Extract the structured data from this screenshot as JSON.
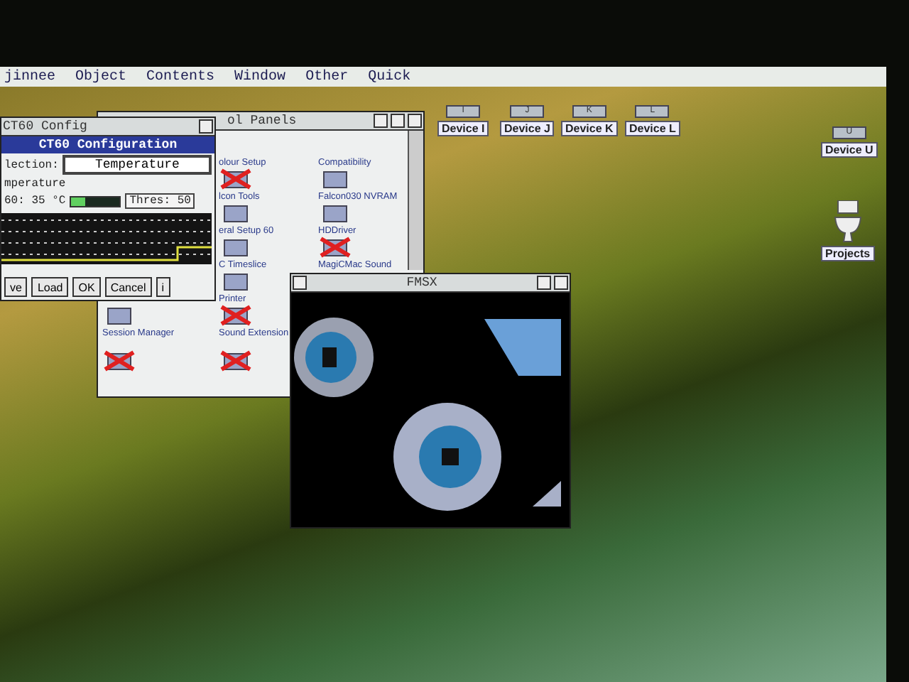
{
  "menu_bar": {
    "items": [
      "jinnee",
      "Object",
      "Contents",
      "Window",
      "Other",
      "Quick"
    ]
  },
  "desktop_icons": [
    {
      "kind": "drive",
      "letter": "I",
      "label": "Device I"
    },
    {
      "kind": "drive",
      "letter": "J",
      "label": "Device J"
    },
    {
      "kind": "drive",
      "letter": "K",
      "label": "Device K"
    },
    {
      "kind": "drive",
      "letter": "L",
      "label": "Device L"
    },
    {
      "kind": "drive",
      "letter": "U",
      "label": "Device U"
    },
    {
      "kind": "trash",
      "label": "Projects"
    }
  ],
  "control_panels": {
    "title": "ol Panels",
    "rows": [
      {
        "cells": [
          null,
          {
            "label": "olour Setup",
            "disabled": false,
            "kind": "blank"
          },
          {
            "label": "Compatibility",
            "disabled": false,
            "kind": "blank"
          }
        ]
      },
      {
        "cells": [
          null,
          {
            "label": "lcon Tools",
            "disabled": true,
            "kind": "module"
          },
          {
            "label": "Falcon030 NVRAM",
            "disabled": false,
            "kind": "module"
          }
        ]
      },
      {
        "cells": [
          null,
          {
            "label": "eral Setup 60",
            "disabled": false,
            "kind": "module"
          },
          {
            "label": "HDDriver",
            "disabled": false,
            "kind": "module"
          }
        ]
      },
      {
        "cells": [
          null,
          {
            "label": "C Timeslice",
            "disabled": false,
            "kind": "module"
          },
          {
            "label": "MagiCMac Sound",
            "disabled": true,
            "kind": "module"
          }
        ]
      },
      {
        "cells": [
          null,
          {
            "label": "Printer",
            "disabled": false,
            "kind": "module"
          }
        ]
      },
      {
        "cells": [
          {
            "label": "Session Manager",
            "disabled": false,
            "kind": "module"
          },
          {
            "label": "Sound Extension",
            "disabled": true,
            "kind": "module"
          }
        ]
      },
      {
        "cells": [
          {
            "disabled": true,
            "kind": "module"
          },
          {
            "disabled": true,
            "kind": "module"
          }
        ]
      }
    ]
  },
  "ct60": {
    "title": "CT60 Config",
    "heading": "CT60 Configuration",
    "selection_label": "lection:",
    "selection_value": "Temperature",
    "group_label": "mperature",
    "reading": "60:  35 °C",
    "level": 0.3,
    "threshold": "Thres: 50",
    "buttons": [
      "ve",
      "Load",
      "OK",
      "Cancel",
      "i"
    ]
  },
  "fmsx": {
    "title": "FMSX"
  }
}
